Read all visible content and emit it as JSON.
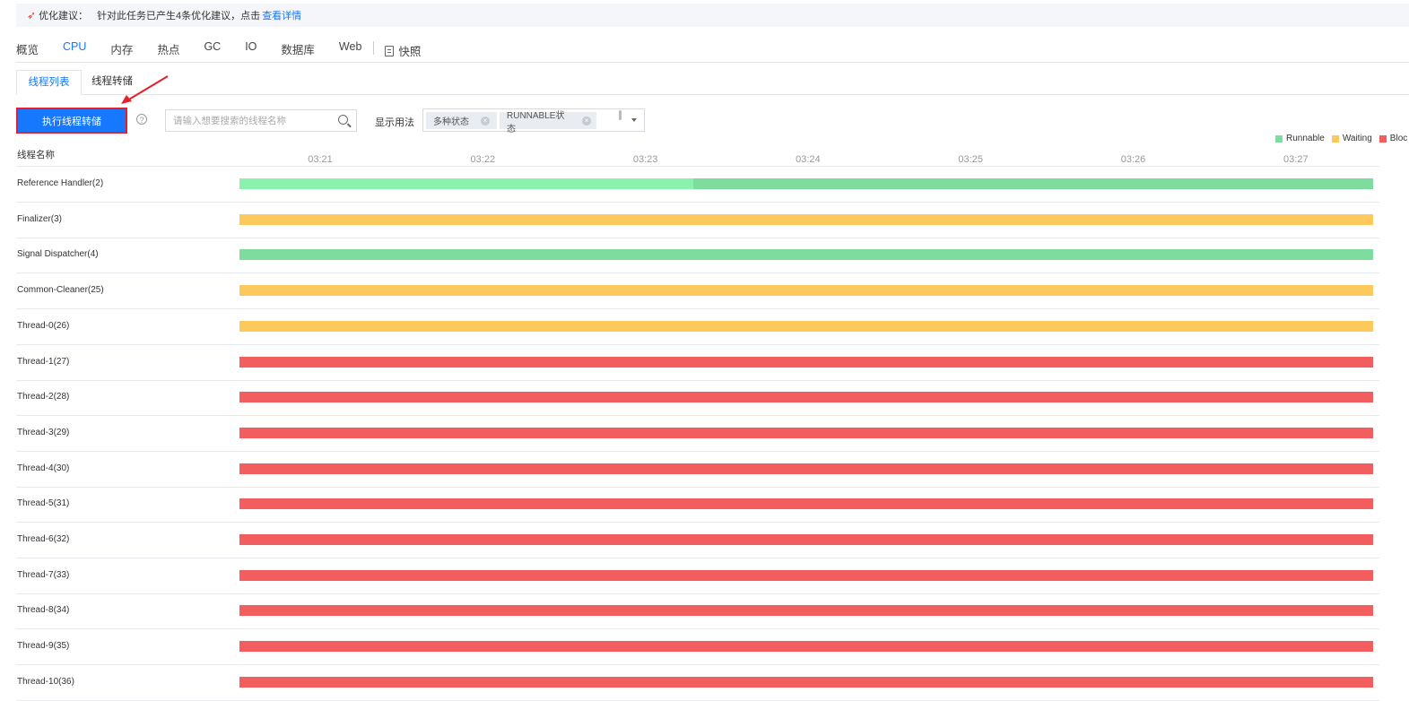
{
  "notice": {
    "title": "优化建议：",
    "message": "针对此任务已产生4条优化建议，点击",
    "link": "查看详情",
    "icon": "rocket-icon"
  },
  "tabs": [
    {
      "label": "概览",
      "active": false
    },
    {
      "label": "CPU",
      "active": true
    },
    {
      "label": "内存",
      "active": false
    },
    {
      "label": "热点",
      "active": false
    },
    {
      "label": "GC",
      "active": false
    },
    {
      "label": "IO",
      "active": false
    },
    {
      "label": "数据库",
      "active": false
    },
    {
      "label": "Web",
      "active": false
    }
  ],
  "snapshot_tab": {
    "label": "快照",
    "icon": "snapshot-icon"
  },
  "subtabs": {
    "list": "线程列表",
    "dump": "线程转储"
  },
  "toolbar": {
    "dump_button": "执行线程转储",
    "help": "?",
    "search_placeholder": "请输入想要搜索的线程名称",
    "display_label": "显示用法",
    "chips": [
      "多种状态",
      "RUNNABLE状态"
    ]
  },
  "colors": {
    "runnable": "#7fdc9f",
    "runnable_light": "#8bf2ad",
    "waiting": "#fdc95c",
    "blocked": "#f25e5e",
    "accent": "#1677ff",
    "highlight": "#e5202c"
  },
  "legend": [
    {
      "label": "Runnable",
      "state": "runnable"
    },
    {
      "label": "Waiting",
      "state": "waiting"
    },
    {
      "label": "Bloc",
      "state": "blocked"
    }
  ],
  "timeline": {
    "column_header": "线程名称",
    "ticks": [
      "03:21",
      "03:22",
      "03:23",
      "03:24",
      "03:25",
      "03:26",
      "03:27"
    ],
    "rows": [
      {
        "name": "Reference Handler(2)",
        "segments": [
          {
            "from": 0,
            "to": 0.4,
            "state": "runnable_light"
          },
          {
            "from": 0.4,
            "to": 1,
            "state": "runnable"
          }
        ]
      },
      {
        "name": "Finalizer(3)",
        "segments": [
          {
            "from": 0,
            "to": 1,
            "state": "waiting"
          }
        ]
      },
      {
        "name": "Signal Dispatcher(4)",
        "segments": [
          {
            "from": 0,
            "to": 1,
            "state": "runnable"
          }
        ]
      },
      {
        "name": "Common-Cleaner(25)",
        "segments": [
          {
            "from": 0,
            "to": 1,
            "state": "waiting"
          }
        ]
      },
      {
        "name": "Thread-0(26)",
        "segments": [
          {
            "from": 0,
            "to": 1,
            "state": "waiting"
          }
        ]
      },
      {
        "name": "Thread-1(27)",
        "segments": [
          {
            "from": 0,
            "to": 1,
            "state": "blocked"
          }
        ]
      },
      {
        "name": "Thread-2(28)",
        "segments": [
          {
            "from": 0,
            "to": 1,
            "state": "blocked"
          }
        ]
      },
      {
        "name": "Thread-3(29)",
        "segments": [
          {
            "from": 0,
            "to": 1,
            "state": "blocked"
          }
        ]
      },
      {
        "name": "Thread-4(30)",
        "segments": [
          {
            "from": 0,
            "to": 1,
            "state": "blocked"
          }
        ]
      },
      {
        "name": "Thread-5(31)",
        "segments": [
          {
            "from": 0,
            "to": 1,
            "state": "blocked"
          }
        ]
      },
      {
        "name": "Thread-6(32)",
        "segments": [
          {
            "from": 0,
            "to": 1,
            "state": "blocked"
          }
        ]
      },
      {
        "name": "Thread-7(33)",
        "segments": [
          {
            "from": 0,
            "to": 1,
            "state": "blocked"
          }
        ]
      },
      {
        "name": "Thread-8(34)",
        "segments": [
          {
            "from": 0,
            "to": 1,
            "state": "blocked"
          }
        ]
      },
      {
        "name": "Thread-9(35)",
        "segments": [
          {
            "from": 0,
            "to": 1,
            "state": "blocked"
          }
        ]
      },
      {
        "name": "Thread-10(36)",
        "segments": [
          {
            "from": 0,
            "to": 1,
            "state": "blocked"
          }
        ]
      }
    ]
  }
}
